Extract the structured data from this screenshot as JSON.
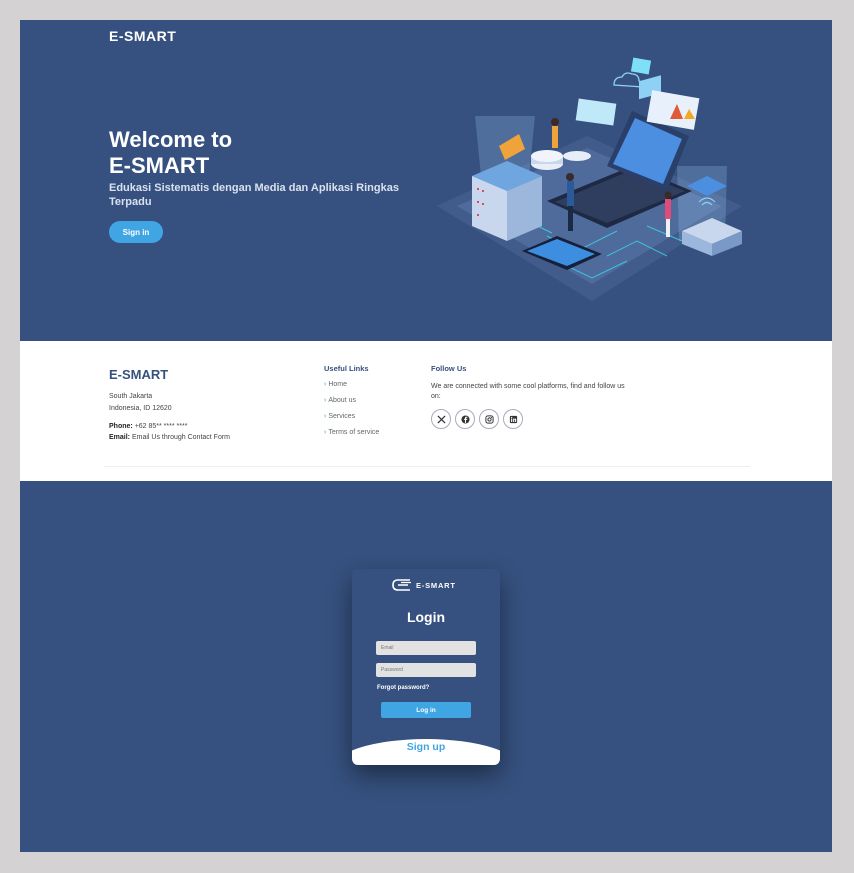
{
  "hero": {
    "brand": "E-SMART",
    "title_line1": "Welcome to",
    "title_line2": "E-SMART",
    "subtitle": "Edukasi Sistematis dengan Media dan Aplikasi Ringkas Terpadu",
    "signin_label": "Sign in"
  },
  "footer": {
    "brand": "E-SMART",
    "address_line1": "South Jakarta",
    "address_line2": "Indonesia, ID 12620",
    "phone_label": "Phone:",
    "phone_value": "+62 85** **** ****",
    "email_label": "Email:",
    "email_value": "Email Us through Contact Form",
    "links_heading": "Useful Links",
    "links": [
      "Home",
      "About us",
      "Services",
      "Terms of service"
    ],
    "follow_heading": "Follow Us",
    "follow_text": "We are connected with some cool platforms, find and follow us on:",
    "socials": [
      "x-icon",
      "facebook-icon",
      "instagram-icon",
      "linkedin-icon"
    ]
  },
  "login": {
    "logo_text": "E-SMART",
    "title": "Login",
    "email_placeholder": "Email",
    "password_placeholder": "Password",
    "forgot_label": "Forgot password?",
    "login_label": "Log in",
    "signup_label": "Sign up"
  },
  "colors": {
    "primary": "#36517f",
    "accent": "#3fa6e3",
    "page_bg": "#d4d2d3"
  }
}
